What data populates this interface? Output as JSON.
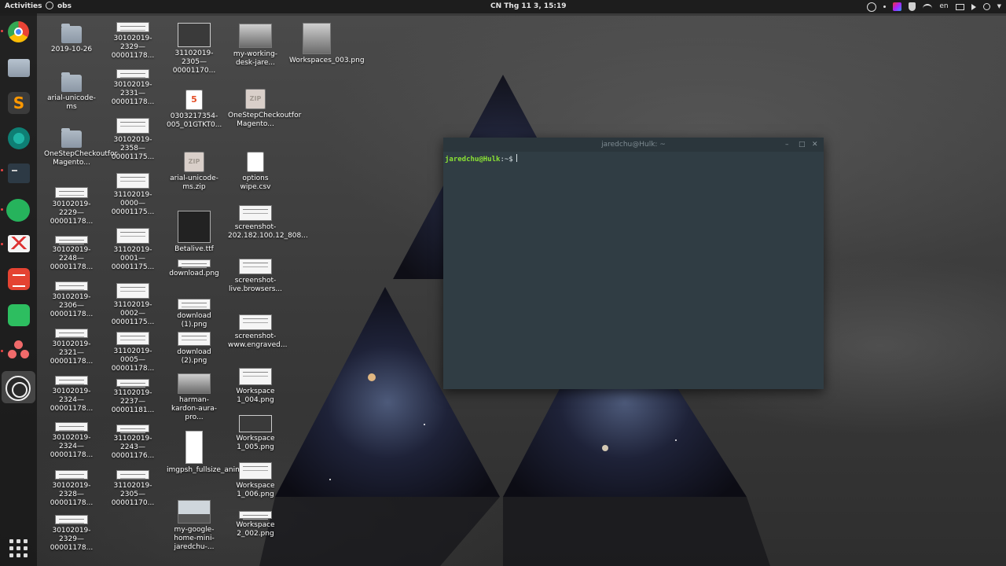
{
  "topbar": {
    "activities": "Activities",
    "app_name": "obs",
    "clock": "CN Thg 11  3, 15:19",
    "lang": "en"
  },
  "dock": {
    "apps": [
      {
        "name": "chrome-icon"
      },
      {
        "name": "files-icon"
      },
      {
        "name": "sublime-text-icon"
      },
      {
        "name": "gitkraken-icon"
      },
      {
        "name": "terminal-icon"
      },
      {
        "name": "messaging-icon"
      },
      {
        "name": "gmail-icon"
      },
      {
        "name": "todoist-icon"
      },
      {
        "name": "evernote-icon"
      },
      {
        "name": "asana-icon"
      },
      {
        "name": "obs-icon"
      },
      {
        "name": "show-applications-icon"
      }
    ]
  },
  "desktop": {
    "col1": [
      {
        "label": "2019-10-26",
        "kind": "folder"
      },
      {
        "label": "arial-unicode-ms",
        "kind": "folder"
      },
      {
        "label": "OneStepCheckoutfor Magento...",
        "kind": "folder"
      },
      {
        "label": "30102019-2229—00001178...",
        "kind": "doc"
      },
      {
        "label": "30102019-2248—00001178...",
        "kind": "doc"
      },
      {
        "label": "30102019-2306—00001178...",
        "kind": "doc"
      },
      {
        "label": "30102019-2321—00001178...",
        "kind": "doc"
      },
      {
        "label": "30102019-2324—00001178...",
        "kind": "doc"
      },
      {
        "label": "30102019-2324—00001178...",
        "kind": "doc"
      },
      {
        "label": "30102019-2328—00001178...",
        "kind": "doc"
      },
      {
        "label": "30102019-2329—00001178...",
        "kind": "doc"
      }
    ],
    "col2": [
      {
        "label": "30102019-2329—00001178...",
        "kind": "doc"
      },
      {
        "label": "30102019-2331—00001178...",
        "kind": "doc"
      },
      {
        "label": "30102019-2358—00001175...",
        "kind": "doc"
      },
      {
        "label": "31102019-0000—00001175...",
        "kind": "doc"
      },
      {
        "label": "31102019-0001—00001175...",
        "kind": "doc"
      },
      {
        "label": "31102019-0002—00001175...",
        "kind": "doc"
      },
      {
        "label": "31102019-0005—00001178...",
        "kind": "doc"
      },
      {
        "label": "31102019-2237—00001181...",
        "kind": "doc"
      },
      {
        "label": "31102019-2243—00001176...",
        "kind": "doc"
      },
      {
        "label": "31102019-2305—00001170...",
        "kind": "doc"
      }
    ],
    "col3": [
      {
        "label": "31102019-2305—00001170...",
        "kind": "dark2"
      },
      {
        "label": "0303217354-005_01GTKT0...",
        "kind": "html5",
        "badge": "5"
      },
      {
        "label": "arial-unicode-ms.zip",
        "kind": "zip",
        "badge": "ZIP"
      },
      {
        "label": "Betalive.ttf",
        "kind": "dark"
      },
      {
        "label": "download.png",
        "kind": "doc"
      },
      {
        "label": "download (1).png",
        "kind": "doc"
      },
      {
        "label": "download (2).png",
        "kind": "doc"
      },
      {
        "label": "harman-kardon-aura-pro...",
        "kind": "photo"
      },
      {
        "label": "imgpsh_fullsize_anim.jpeg",
        "kind": "phone"
      },
      {
        "label": "my-google-home-mini-jaredchu-...",
        "kind": "house"
      }
    ],
    "col4": [
      {
        "label": "my-working-desk-jare...",
        "kind": "photo"
      },
      {
        "label": "OneStepCheckoutfor Magento...",
        "kind": "zip",
        "badge": "ZIP"
      },
      {
        "label": "options wipe.csv",
        "kind": "csv"
      },
      {
        "label": "screenshot-202.182.100.12_808...",
        "kind": "doc"
      },
      {
        "label": "screenshot-live.browsers...",
        "kind": "doc"
      },
      {
        "label": "screenshot-www.engraved...",
        "kind": "doc"
      },
      {
        "label": "Workspace 1_004.png",
        "kind": "doc"
      },
      {
        "label": "Workspace 1_005.png",
        "kind": "dark2"
      },
      {
        "label": "Workspace 1_006.png",
        "kind": "doc"
      },
      {
        "label": "Workspace 2_002.png",
        "kind": "doc"
      }
    ],
    "col5": [
      {
        "label": "Workspaces_003.png",
        "kind": "photo"
      }
    ]
  },
  "terminal": {
    "title": "jaredchu@Hulk: ~",
    "prompt_user": "jaredchu@Hulk",
    "prompt_rest": ":~$",
    "min": "–",
    "max": "□",
    "close": "✕"
  }
}
